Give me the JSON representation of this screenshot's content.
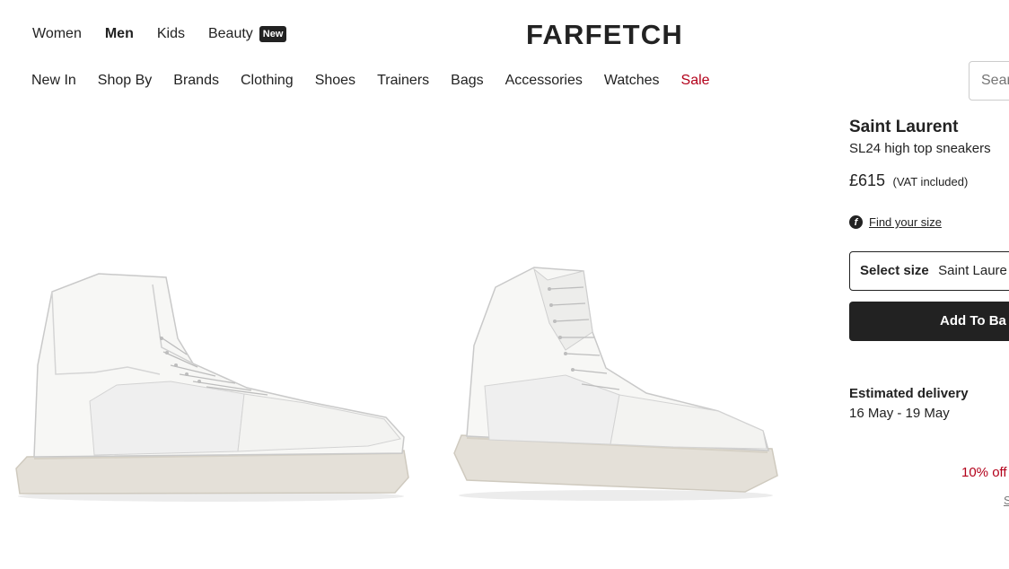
{
  "header": {
    "logo": "FARFETCH",
    "gender_nav": [
      {
        "label": "Women",
        "active": false
      },
      {
        "label": "Men",
        "active": true
      },
      {
        "label": "Kids",
        "active": false
      }
    ],
    "beauty": {
      "label": "Beauty",
      "badge": "New"
    },
    "categories": [
      "New In",
      "Shop By",
      "Brands",
      "Clothing",
      "Shoes",
      "Trainers",
      "Bags",
      "Accessories",
      "Watches",
      "Sale"
    ],
    "search": {
      "placeholder": "Sear"
    }
  },
  "product": {
    "brand": "Saint Laurent",
    "name": "SL24 high top sneakers",
    "price": "£615",
    "vat": "(VAT included)",
    "find_size": "Find your size",
    "size_icon": "f",
    "select_size_label": "Select size",
    "select_size_value": "Saint Laure",
    "add_to_bag": "Add To Ba",
    "delivery_title": "Estimated delivery",
    "delivery_dates": "16 May - 19 May",
    "promo": "10% off",
    "promo_link": "S"
  },
  "colors": {
    "text": "#222222",
    "sale": "#b3001a",
    "border": "#cccccc"
  },
  "icons": {
    "size_guide": "farfetch-f-icon",
    "product_images": [
      "sneaker-side-image",
      "sneaker-angle-image"
    ]
  }
}
